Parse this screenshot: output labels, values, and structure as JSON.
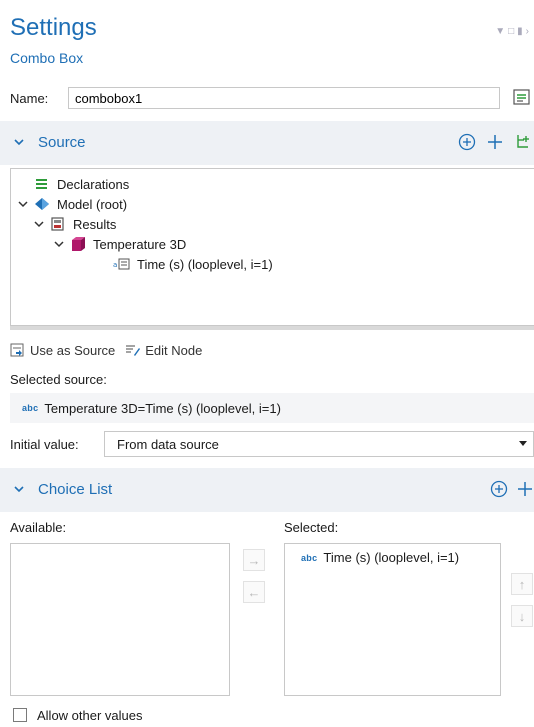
{
  "header": {
    "title": "Settings",
    "subtitle": "Combo Box"
  },
  "name_field": {
    "label": "Name:",
    "value": "combobox1"
  },
  "source_section": {
    "title": "Source",
    "tree": [
      {
        "label": "Declarations",
        "icon": "list-icon"
      },
      {
        "label": "Model (root)",
        "icon": "model-icon"
      },
      {
        "label": "Results",
        "icon": "results-icon"
      },
      {
        "label": "Temperature 3D",
        "icon": "cube-icon"
      },
      {
        "label": "Time (s) (looplevel, i=1)",
        "icon": "parameter-icon"
      }
    ],
    "use_as_source_label": "Use as Source",
    "edit_node_label": "Edit Node",
    "selected_source_label": "Selected source:",
    "selected_source_value": "Temperature 3D=Time (s) (looplevel, i=1)",
    "initial_value_label": "Initial value:",
    "initial_value": "From data source"
  },
  "choice_list": {
    "title": "Choice List",
    "available_label": "Available:",
    "selected_label": "Selected:",
    "selected_items": [
      "Time (s) (looplevel, i=1)"
    ],
    "allow_other_values_label": "Allow other values",
    "allow_other_values_checked": false
  },
  "abc_tag": "abc",
  "colors": {
    "accent": "#1f6fb5",
    "section_bg": "#eef1f5",
    "add_green": "#2e9c3a"
  }
}
